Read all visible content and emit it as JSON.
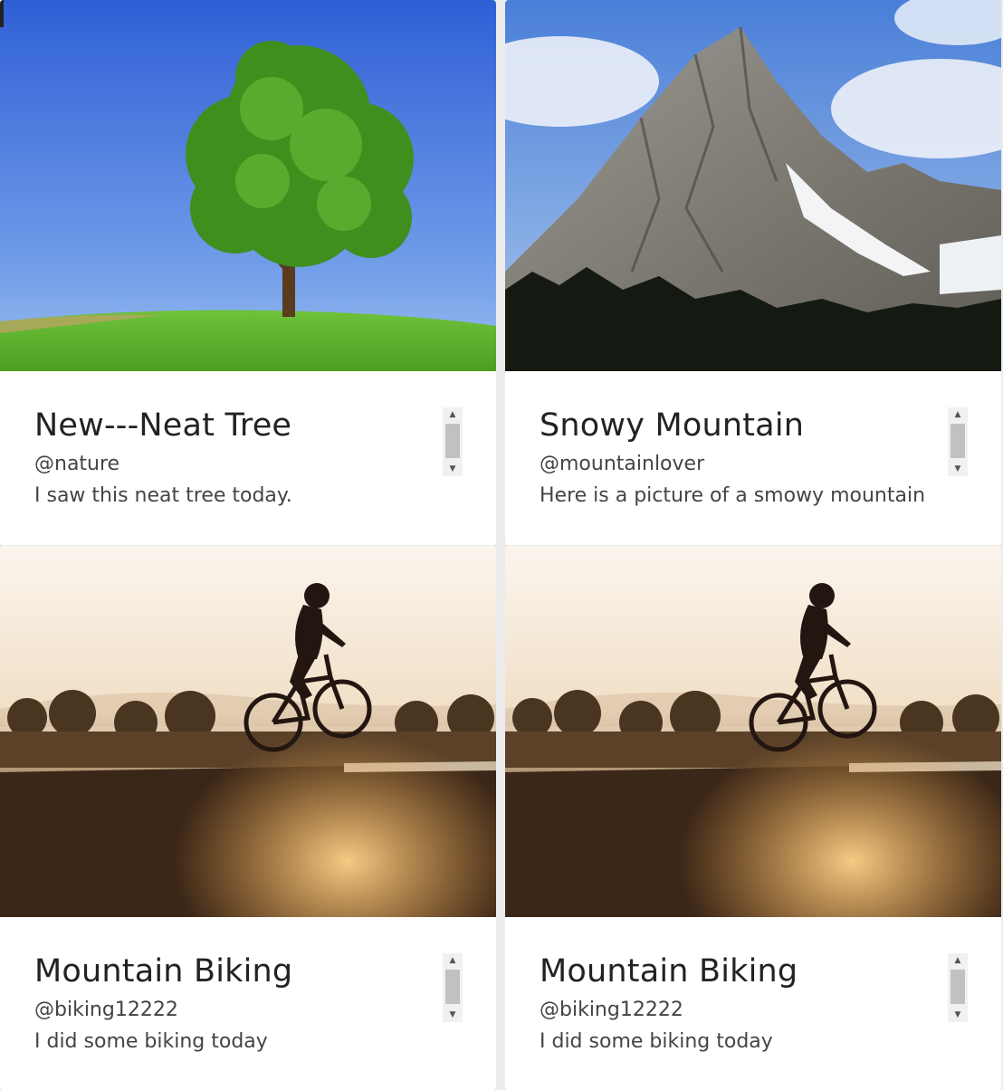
{
  "posts": [
    {
      "title": "New---Neat Tree",
      "handle": "@nature",
      "caption": "I saw this neat tree today.",
      "image_icon": "tree-photo"
    },
    {
      "title": "Snowy Mountain",
      "handle": "@mountainlover",
      "caption": "Here is a picture of a smowy mountain",
      "image_icon": "mountain-photo"
    },
    {
      "title": "Mountain Biking",
      "handle": "@biking12222",
      "caption": "I did some biking today",
      "image_icon": "biking-photo"
    },
    {
      "title": "Mountain Biking",
      "handle": "@biking12222",
      "caption": "I did some biking today",
      "image_icon": "biking-photo"
    }
  ],
  "scrollbar": {
    "up_glyph": "▲",
    "down_glyph": "▼"
  }
}
